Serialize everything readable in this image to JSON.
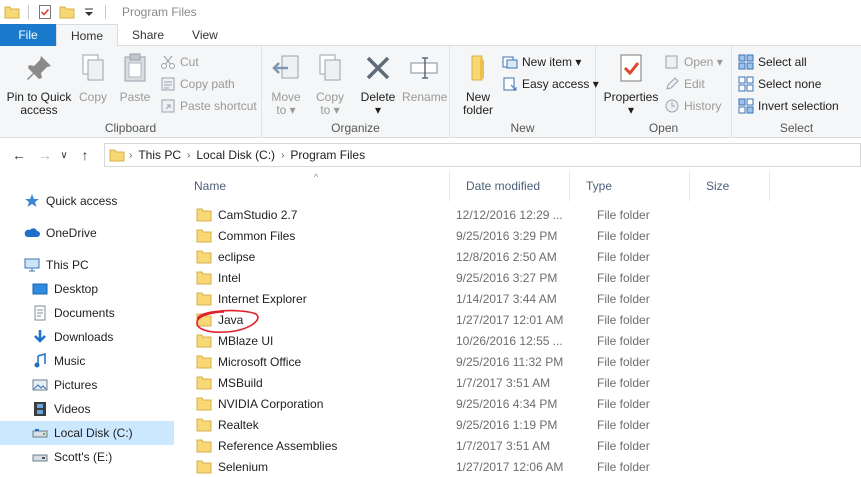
{
  "window": {
    "title": "Program Files"
  },
  "quick_access_toolbar": {
    "icons": [
      "folder-icon",
      "properties-check-icon",
      "new-folder-icon",
      "customize-dropdown-icon"
    ]
  },
  "ribbon_tabs": [
    {
      "label": "File"
    },
    {
      "label": "Home"
    },
    {
      "label": "Share"
    },
    {
      "label": "View"
    }
  ],
  "ribbon": {
    "clipboard": {
      "label": "Clipboard",
      "pin_label": "Pin to Quick\naccess",
      "copy_label": "Copy",
      "paste_label": "Paste",
      "cut_label": "Cut",
      "copy_path_label": "Copy path",
      "paste_shortcut_label": "Paste shortcut"
    },
    "organize": {
      "label": "Organize",
      "move_to_label": "Move\nto ▾",
      "copy_to_label": "Copy\nto ▾",
      "delete_label": "Delete\n▾",
      "rename_label": "Rename"
    },
    "new": {
      "label": "New",
      "new_folder_label": "New\nfolder",
      "new_item_label": "New item ▾",
      "easy_access_label": "Easy access ▾"
    },
    "open": {
      "label": "Open",
      "properties_label": "Properties\n▾",
      "open_label": "Open ▾",
      "edit_label": "Edit",
      "history_label": "History"
    },
    "select": {
      "label": "Select",
      "select_all_label": "Select all",
      "select_none_label": "Select none",
      "invert_label": "Invert selection"
    }
  },
  "address_bar": {
    "back": "←",
    "forward": "→",
    "recent": "∨",
    "up": "↑",
    "crumbs": [
      "This PC",
      "Local Disk (C:)",
      "Program Files"
    ],
    "separator": "›"
  },
  "nav_pane": {
    "items": [
      {
        "label": "Quick access",
        "icon": "star-icon"
      },
      {
        "label": "OneDrive",
        "icon": "onedrive-cloud-icon"
      },
      {
        "label": "This PC",
        "icon": "computer-icon"
      },
      {
        "label": "Desktop",
        "icon": "desktop-icon"
      },
      {
        "label": "Documents",
        "icon": "documents-icon"
      },
      {
        "label": "Downloads",
        "icon": "download-arrow-icon"
      },
      {
        "label": "Music",
        "icon": "music-note-icon"
      },
      {
        "label": "Pictures",
        "icon": "pictures-icon"
      },
      {
        "label": "Videos",
        "icon": "film-icon"
      },
      {
        "label": "Local Disk (C:)",
        "icon": "drive-icon",
        "selected": true
      },
      {
        "label": "Scott's (E:)",
        "icon": "removable-drive-icon"
      }
    ]
  },
  "file_list": {
    "columns": [
      "Name",
      "Date modified",
      "Type",
      "Size"
    ],
    "sort_indicator": "^",
    "rows": [
      {
        "name": "CamStudio 2.7",
        "date": "12/12/2016 12:29 ...",
        "type": "File folder"
      },
      {
        "name": "Common Files",
        "date": "9/25/2016 3:29 PM",
        "type": "File folder"
      },
      {
        "name": "eclipse",
        "date": "12/8/2016 2:50 AM",
        "type": "File folder"
      },
      {
        "name": "Intel",
        "date": "9/25/2016 3:27 PM",
        "type": "File folder"
      },
      {
        "name": "Internet Explorer",
        "date": "1/14/2017 3:44 AM",
        "type": "File folder"
      },
      {
        "name": "Java",
        "date": "1/27/2017 12:01 AM",
        "type": "File folder",
        "circled": true
      },
      {
        "name": "MBlaze UI",
        "date": "10/26/2016 12:55 ...",
        "type": "File folder"
      },
      {
        "name": "Microsoft Office",
        "date": "9/25/2016 11:32 PM",
        "type": "File folder"
      },
      {
        "name": "MSBuild",
        "date": "1/7/2017 3:51 AM",
        "type": "File folder"
      },
      {
        "name": "NVIDIA Corporation",
        "date": "9/25/2016 4:34 PM",
        "type": "File folder"
      },
      {
        "name": "Realtek",
        "date": "9/25/2016 1:19 PM",
        "type": "File folder"
      },
      {
        "name": "Reference Assemblies",
        "date": "1/7/2017 3:51 AM",
        "type": "File folder"
      },
      {
        "name": "Selenium",
        "date": "1/27/2017 12:06 AM",
        "type": "File folder"
      }
    ]
  },
  "colors": {
    "file_tab": "#1979ca",
    "folder": "#f8d775",
    "selection": "#cce8ff",
    "annotation": "#e0202a",
    "column_header_text": "#4c607a"
  }
}
